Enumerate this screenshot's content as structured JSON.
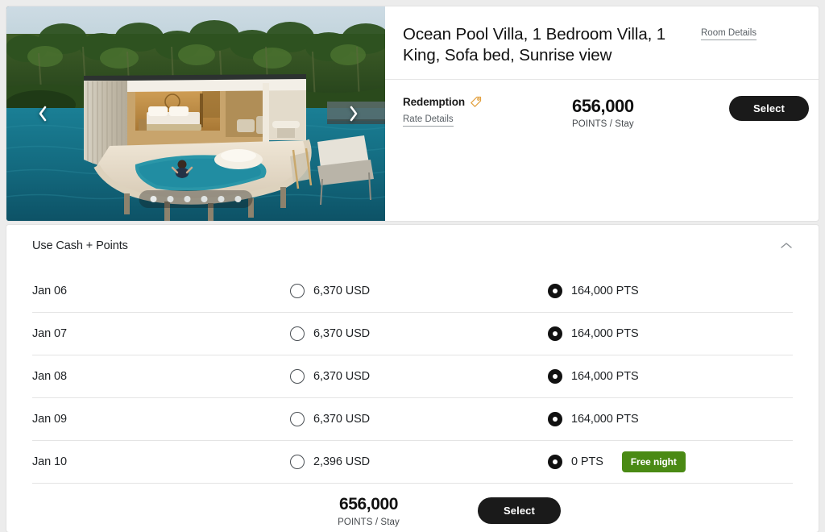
{
  "room": {
    "title": "Ocean Pool Villa, 1 Bedroom Villa, 1 King, Sofa bed, Sunrise view",
    "details_link": "Room Details",
    "gallery": {
      "prev_label": "Previous image",
      "next_label": "Next image",
      "dot_count": 6,
      "active_dot": 0
    }
  },
  "rate": {
    "type_label": "Redemption",
    "tag_icon": "tag-icon",
    "details_link": "Rate Details",
    "points_value": "656,000",
    "points_unit": "POINTS / Stay",
    "select_label": "Select"
  },
  "cash_points": {
    "title": "Use Cash + Points",
    "collapse_icon": "chevron-up-icon",
    "expanded": true,
    "rows": [
      {
        "date": "Jan 06",
        "cash": "6,370 USD",
        "cash_selected": false,
        "points": "164,000 PTS",
        "points_selected": true,
        "badge": null
      },
      {
        "date": "Jan 07",
        "cash": "6,370 USD",
        "cash_selected": false,
        "points": "164,000 PTS",
        "points_selected": true,
        "badge": null
      },
      {
        "date": "Jan 08",
        "cash": "6,370 USD",
        "cash_selected": false,
        "points": "164,000 PTS",
        "points_selected": true,
        "badge": null
      },
      {
        "date": "Jan 09",
        "cash": "6,370 USD",
        "cash_selected": false,
        "points": "164,000 PTS",
        "points_selected": true,
        "badge": null
      },
      {
        "date": "Jan 10",
        "cash": "2,396 USD",
        "cash_selected": false,
        "points": "0 PTS",
        "points_selected": true,
        "badge": "Free night"
      }
    ],
    "total_value": "656,000",
    "total_unit": "POINTS / Stay",
    "select_label": "Select"
  },
  "colors": {
    "accent_tag": "#E2A03F",
    "badge_green": "#4A8A14",
    "button_dark": "#1A1A1A",
    "page_background": "#ECECEC"
  }
}
